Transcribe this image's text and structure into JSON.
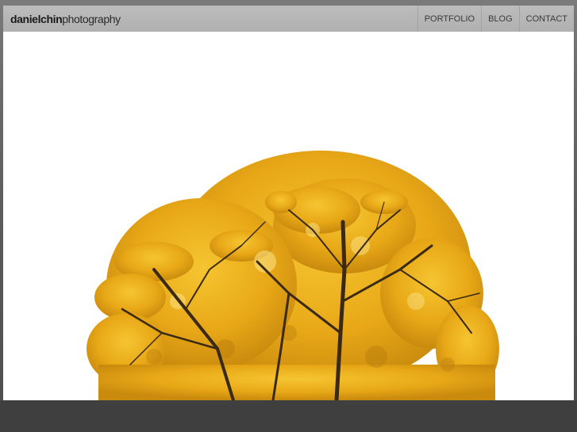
{
  "header": {
    "logo_bold": "danielchin",
    "logo_light": "photography"
  },
  "nav": {
    "items": [
      {
        "label": "PORTFOLIO"
      },
      {
        "label": "BLOG"
      },
      {
        "label": "CONTACT"
      }
    ]
  },
  "colors": {
    "header_bg": "#b5b5b5",
    "foliage": "#e8a817",
    "branches": "#3a2a14",
    "page_bg": "#ffffff",
    "outer_bg": "#5a5a5a"
  }
}
